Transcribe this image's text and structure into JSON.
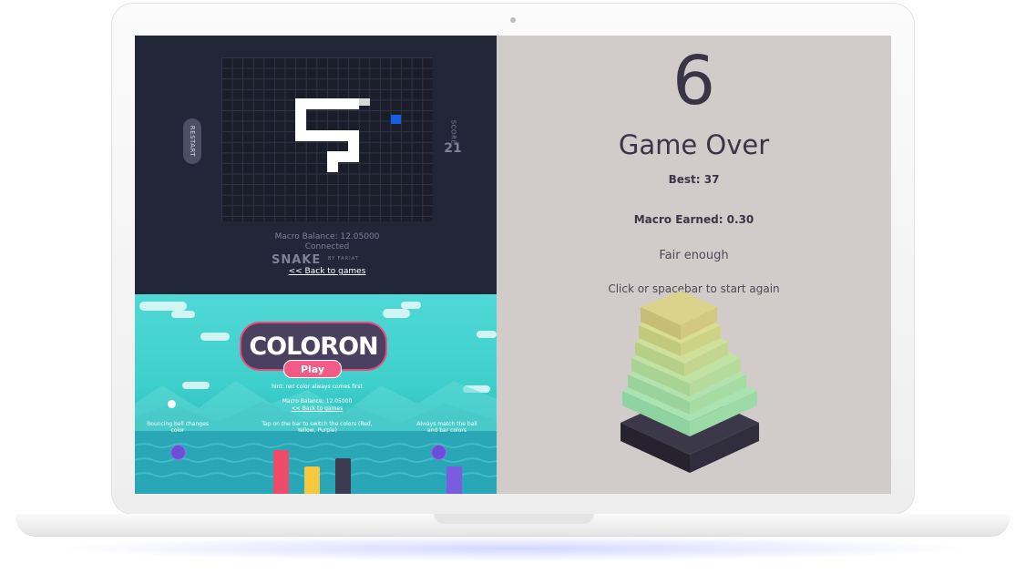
{
  "snake_game": {
    "restart_label": "RESTART",
    "score_label": "SCORE",
    "score_value": "21",
    "macro_balance": "Macro Balance: 12.05000",
    "status": "Connected",
    "title": "SNAKE",
    "byline": "BY FARIAT",
    "back_link": "<< Back to games"
  },
  "coloron_game": {
    "logo": "COLORON",
    "play_label": "Play",
    "hint": "hint: red color always comes first",
    "macro_balance": "Macro Balance: 12.05000",
    "back_link": "<< Back to games",
    "instruction_left": "Bouncing ball changes color",
    "instruction_center": "Tap on the bar to switch the colors (Red, Yellow, Purple)",
    "instruction_right": "Always match the ball and bar colors",
    "colors": {
      "red": "#ee4b6a",
      "yellow": "#f5c93f",
      "purple": "#7b5ce0",
      "dark": "#3d3b52"
    }
  },
  "tower_game": {
    "score": "6",
    "game_over": "Game Over",
    "best": "Best: 37",
    "macro_earned": "Macro Earned: 0.30",
    "message": "Fair enough",
    "restart_prompt": "Click or spacebar to start again"
  }
}
